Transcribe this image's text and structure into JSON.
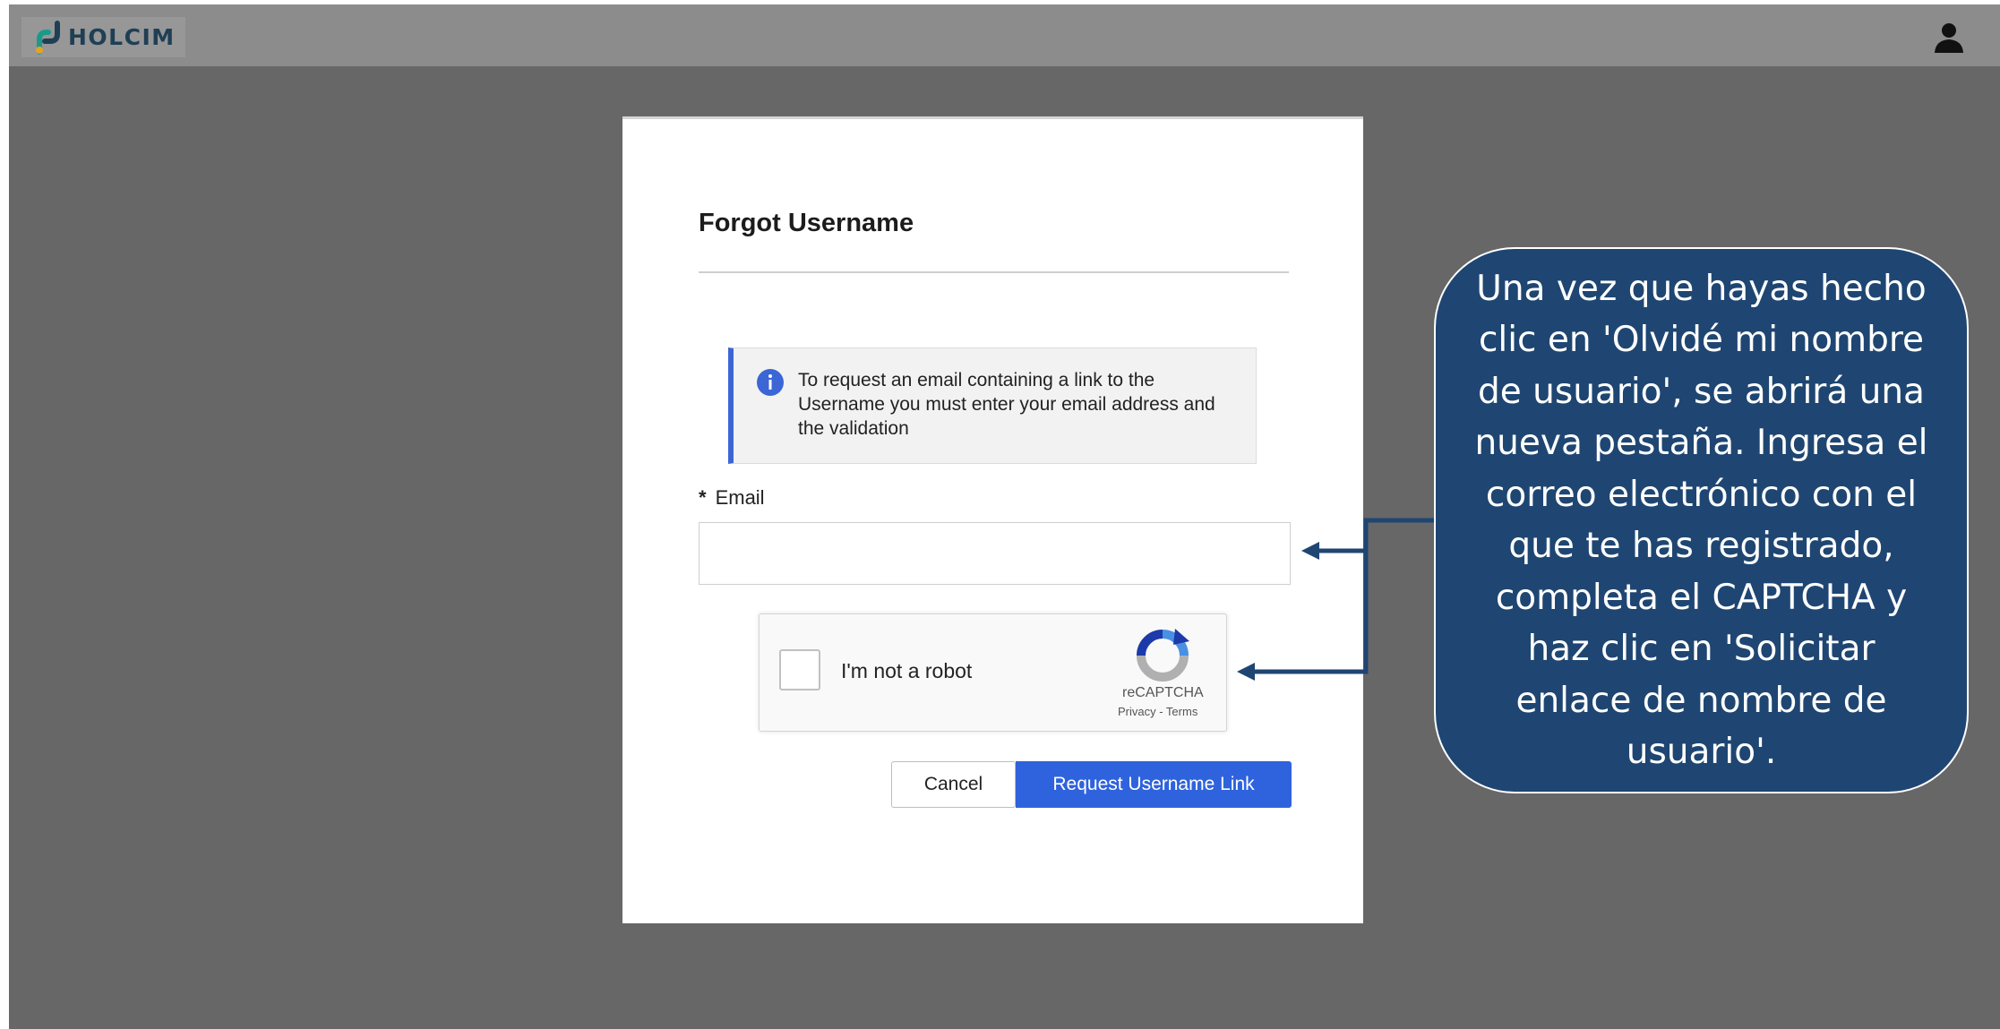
{
  "header": {
    "logo_text": "HOLCIM",
    "logo_icon": "holcim-logo-mark",
    "user_icon": "user-silhouette-icon"
  },
  "form": {
    "title": "Forgot Username",
    "info_icon": "info-icon",
    "info_text": "To request an email containing a link to the Username you must enter your email address and the validation",
    "email_required_marker": "*",
    "email_label": "Email",
    "email_value": "",
    "recaptcha": {
      "label": "I'm not a robot",
      "brand": "reCAPTCHA",
      "links": "Privacy - Terms"
    },
    "cancel_label": "Cancel",
    "submit_label": "Request Username Link"
  },
  "callout": {
    "text": "Una vez que hayas hecho clic en 'Olvidé mi nombre de usuario', se abrirá una nueva pestaña. Ingresa el correo electrónico con el que te has registrado, completa el CAPTCHA y haz clic en 'Solicitar enlace de nombre de usuario'."
  },
  "colors": {
    "backdrop": "#676767",
    "topbar": "#8c8c8c",
    "accent_blue": "#2f63dd",
    "callout_fill": "#1f4672"
  }
}
